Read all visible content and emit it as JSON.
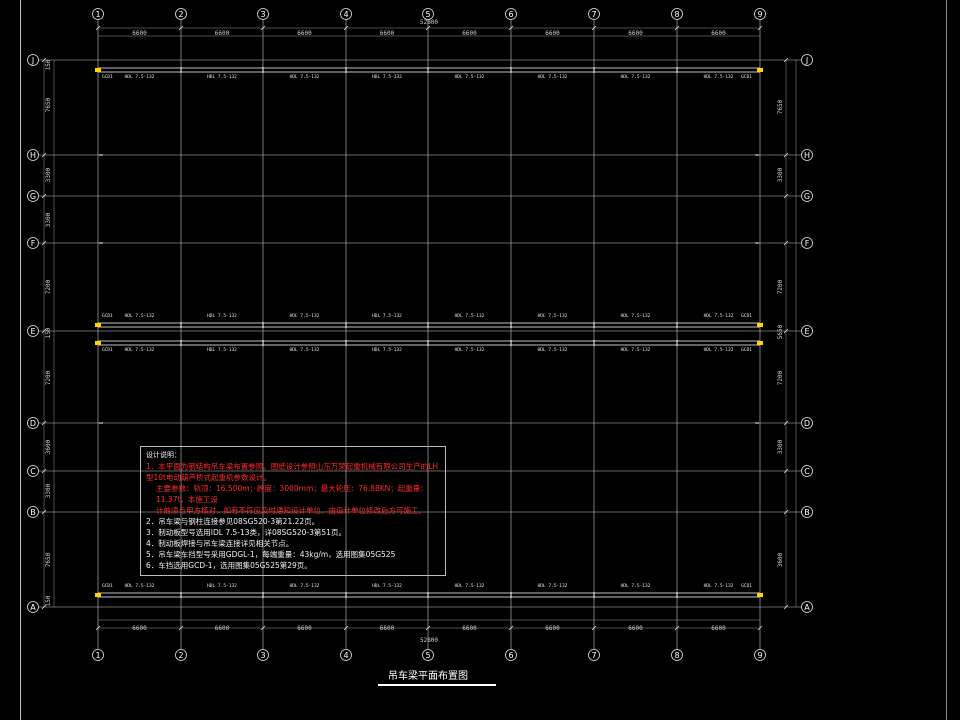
{
  "drawing": {
    "title": "吊车梁平面布置图",
    "total_dimension": "52800",
    "top_dims": [
      "6600",
      "6600",
      "6600",
      "6600",
      "6600",
      "6600",
      "6600",
      "6600"
    ],
    "bottom_dims": [
      "6600",
      "6600",
      "6600",
      "6600",
      "6600",
      "6600",
      "6600",
      "6600"
    ],
    "column_axes": [
      "1",
      "2",
      "3",
      "4",
      "5",
      "6",
      "7",
      "8",
      "9"
    ],
    "row_axes_left": [
      "J",
      "H",
      "G",
      "F",
      "E",
      "D",
      "C",
      "B",
      "A"
    ],
    "row_axes_right": [
      "J",
      "H",
      "G",
      "F",
      "E",
      "D",
      "C",
      "B",
      "A"
    ],
    "left_dims": [
      "150",
      "7650",
      "3300",
      "3300",
      "7200",
      "150",
      "7200",
      "3600",
      "3300",
      "7650",
      "150"
    ],
    "right_dims": [
      "7650",
      "3300",
      "7200",
      "5650",
      "7200",
      "3300",
      "3600"
    ],
    "beam_label": "HDL 7.5-132",
    "end_label": "GCD1"
  },
  "notes": {
    "title": "设计说明：",
    "line1": "1．本平面为钢结构吊车梁布置参照。图纸设计参照山东万荣起重机械有限公司生产的LH型10t电动葫芦桥式起重机参数设计。",
    "line1b": "主要参数：轨顶：16.500m；跨度：3000mm；最大轮压：76.88KN；起重量：11.37t，本施工设",
    "line1c": "计前须与甲方核对，如有不符应及时通知设计单位，由设计单位修改后方可施工。",
    "line2": "2．吊车梁与钢柱连接参见08SG520-3第21.22页。",
    "line3": "3．制动板型号选用IDL 7.5-13类，详08SG520-3第51页。",
    "line4": "4．制动板焊接与吊车梁连接详见相关节点。",
    "line5": "5．吊车梁车挡型号采用GDGL-1，每端重量：43kg/m，选用图集05G525",
    "line6": "6．车挡选用GCD-1，选用图集05G525第29页。"
  }
}
